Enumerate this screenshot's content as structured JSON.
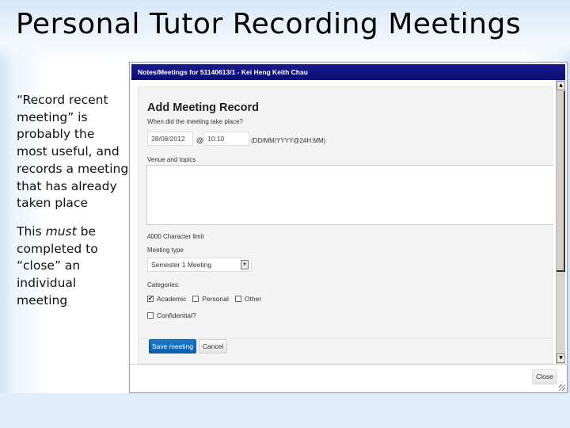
{
  "slide": {
    "title": "Personal Tutor Recording Meetings",
    "paragraph1": "“Record recent meeting” is probably the most useful, and records a meeting that has already taken place",
    "paragraph2_before": "This ",
    "paragraph2_emphasis": "must",
    "paragraph2_after": " be completed to “close” an individual meeting"
  },
  "dialog": {
    "title": "Notes/Meetings for 51140613/1 - Kei Heng Keith Chau",
    "form": {
      "heading": "Add Meeting Record",
      "when_label": "When did the meeting take place?",
      "date_value": "28/08/2012",
      "at_symbol": "@",
      "time_value": "10:10",
      "format_hint": "(DD/MM/YYYY@24H:MM)",
      "venue_label": "Venue and topics",
      "venue_value": "",
      "char_limit": "4000 Character limit",
      "meeting_type_label": "Meeting type",
      "meeting_type_value": "Semester 1 Meeting",
      "categories_label": "Categories:",
      "categories": [
        {
          "label": "Academic",
          "checked": true
        },
        {
          "label": "Personal",
          "checked": false
        },
        {
          "label": "Other",
          "checked": false
        }
      ],
      "confidential_label": "Confidential?",
      "confidential_checked": false,
      "save_label": "Save meeting",
      "cancel_label": "Cancel"
    },
    "close_label": "Close",
    "icons": {
      "scroll_up": "▲",
      "scroll_down": "▼",
      "select_arrow": "▼",
      "check_mark": "✔"
    },
    "colors": {
      "titlebar": "#12127f",
      "save_button": "#1a70c0"
    }
  }
}
